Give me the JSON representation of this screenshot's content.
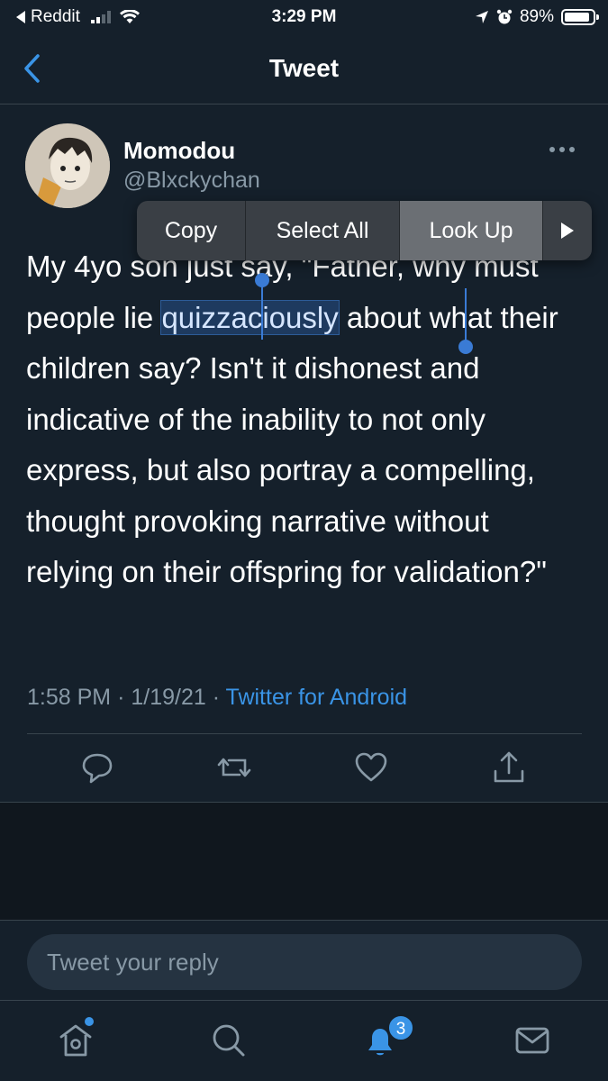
{
  "status_bar": {
    "back_app": "Reddit",
    "time": "3:29 PM",
    "battery": "89%",
    "battery_level": 0.89
  },
  "header": {
    "title": "Tweet"
  },
  "tweet": {
    "author_name": "Momodou",
    "author_handle": "@Blxckychan",
    "text_before": "My 4yo son just say, \"Father, why must people lie ",
    "selected_word": "quizzaciously",
    "text_after": " about what their children say? Isn't it dishonest and indicative of the inability to not only express, but also portray a compelling, thought provoking narrative without relying on their offspring for validation?\"",
    "time": "1:58 PM",
    "date": "1/19/21",
    "separator": "·",
    "source": "Twitter for Android"
  },
  "context_menu": {
    "items": [
      "Copy",
      "Select All",
      "Look Up"
    ],
    "highlighted": "Look Up"
  },
  "reply": {
    "placeholder": "Tweet your reply"
  },
  "bottom_nav": {
    "items": [
      "home-icon",
      "search-icon",
      "notifications-icon",
      "messages-icon"
    ],
    "notification_count": "3"
  },
  "colors": {
    "background": "#15202b",
    "accent": "#3a94e6",
    "secondary_text": "#8899a6"
  }
}
